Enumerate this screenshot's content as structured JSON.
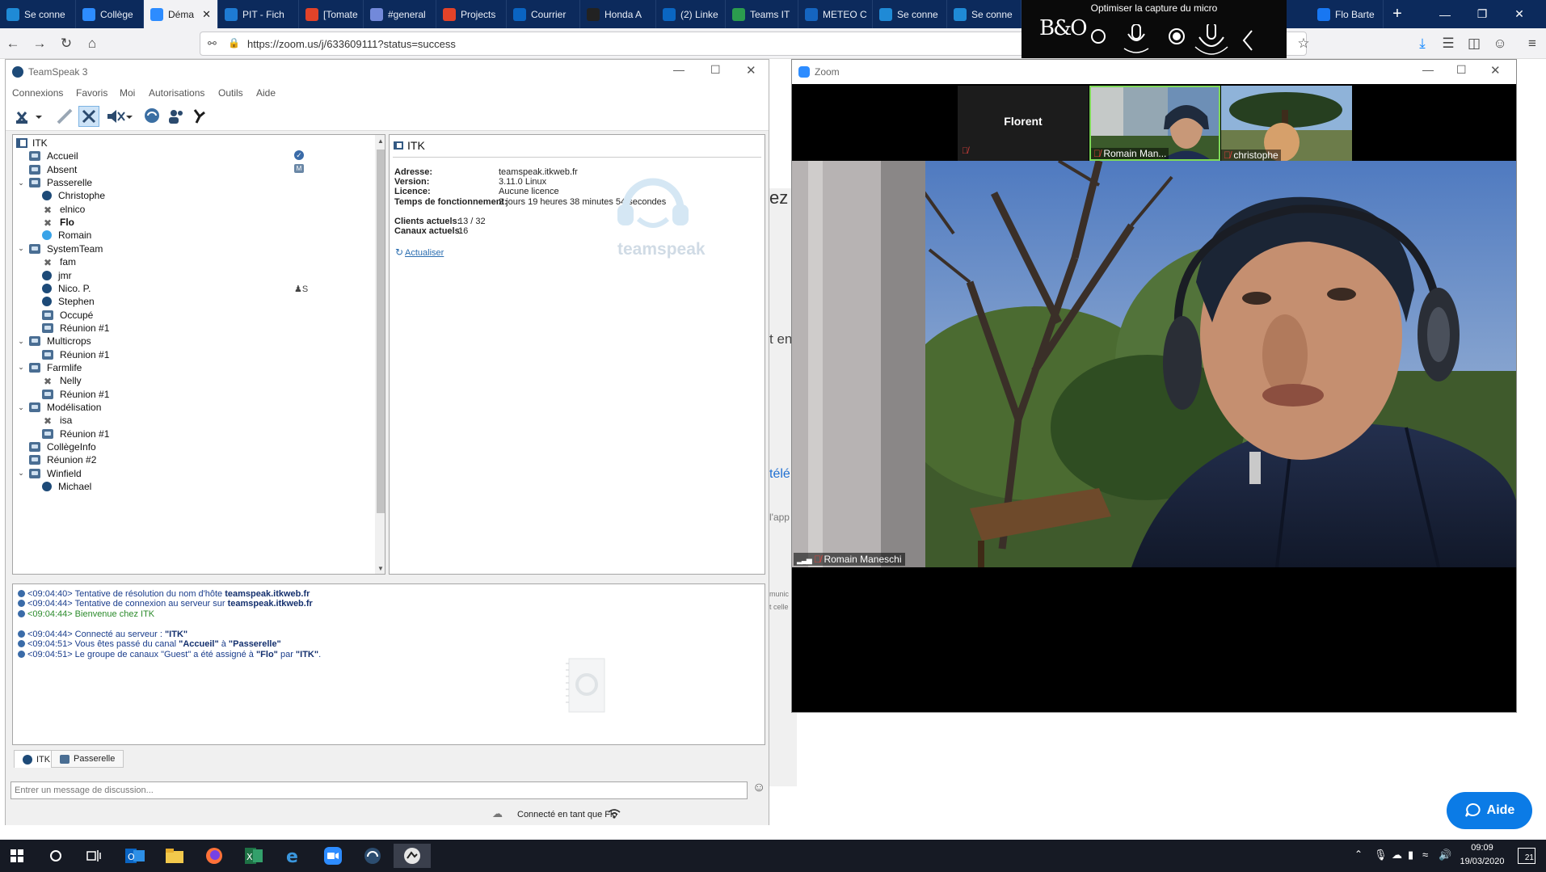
{
  "browser": {
    "tabs": [
      {
        "label": "Se conne",
        "icon": "cloud-icon",
        "color": "#1f8ad6"
      },
      {
        "label": "Collège",
        "icon": "zoom-icon",
        "color": "#2d8cff"
      },
      {
        "label": "Déma",
        "icon": "zoom-icon",
        "color": "#2d8cff",
        "active": true
      },
      {
        "label": "PIT - Fich",
        "icon": "nextcloud-icon",
        "color": "#1e7bd3"
      },
      {
        "label": "[Tomate",
        "icon": "gitlab-icon",
        "color": "#e24329"
      },
      {
        "label": "#general",
        "icon": "discord-icon",
        "color": "#7289da"
      },
      {
        "label": "Projects",
        "icon": "gitlab-icon",
        "color": "#e24329"
      },
      {
        "label": "Courrier",
        "icon": "outlook-icon",
        "color": "#0a64c2"
      },
      {
        "label": "Honda A",
        "icon": "honda-icon",
        "color": "#222222"
      },
      {
        "label": "(2) Linke",
        "icon": "linkedin-icon",
        "color": "#0a66c2"
      },
      {
        "label": "Teams IT",
        "icon": "teams-icon",
        "color": "#2b9c4e"
      },
      {
        "label": "METEO C",
        "icon": "meteo-icon",
        "color": "#1565c0"
      },
      {
        "label": "Se conne",
        "icon": "cloud-icon",
        "color": "#1f8ad6"
      },
      {
        "label": "Se conne",
        "icon": "cloud-icon",
        "color": "#1f8ad6"
      },
      {
        "label": "Flo Barte",
        "icon": "facebook-icon",
        "color": "#1877f2"
      }
    ],
    "url": "https://zoom.us/j/633609111?status=success"
  },
  "bo_overlay": {
    "title": "Optimiser la capture du micro",
    "logo": "B&O"
  },
  "teamspeak": {
    "title": "TeamSpeak 3",
    "menu": [
      "Connexions",
      "Favoris",
      "Moi",
      "Autorisations",
      "Outils",
      "Aide"
    ],
    "tree": {
      "server": "ITK",
      "rows": [
        {
          "label": "Accueil",
          "kind": "channel",
          "level": 1
        },
        {
          "label": "Absent",
          "kind": "channel",
          "level": 1
        },
        {
          "label": "Passerelle",
          "kind": "channel",
          "level": 1,
          "expanded": true
        },
        {
          "label": "Christophe",
          "kind": "user",
          "level": 2
        },
        {
          "label": "elnico",
          "kind": "user-muted",
          "level": 2
        },
        {
          "label": "Flo",
          "kind": "user-muted",
          "level": 2,
          "bold": true
        },
        {
          "label": "Romain",
          "kind": "user-talking",
          "level": 2
        },
        {
          "label": "SystemTeam",
          "kind": "channel",
          "level": 1,
          "expanded": true
        },
        {
          "label": "fam",
          "kind": "user-muted",
          "level": 2
        },
        {
          "label": "jmr",
          "kind": "user",
          "level": 2
        },
        {
          "label": "Nico. P.",
          "kind": "user",
          "level": 2
        },
        {
          "label": "Stephen",
          "kind": "user",
          "level": 2
        },
        {
          "label": "Occupé",
          "kind": "channel",
          "level": 2
        },
        {
          "label": "Réunion #1",
          "kind": "channel",
          "level": 2
        },
        {
          "label": "Multicrops",
          "kind": "channel",
          "level": 1,
          "expanded": true
        },
        {
          "label": "Réunion #1",
          "kind": "channel",
          "level": 2
        },
        {
          "label": "Farmlife",
          "kind": "channel",
          "level": 1,
          "expanded": true
        },
        {
          "label": "Nelly",
          "kind": "user-muted",
          "level": 2
        },
        {
          "label": "Réunion #1",
          "kind": "channel",
          "level": 2
        },
        {
          "label": "Modélisation",
          "kind": "channel",
          "level": 1,
          "expanded": true
        },
        {
          "label": "isa",
          "kind": "user-muted",
          "level": 2
        },
        {
          "label": "Réunion #1",
          "kind": "channel",
          "level": 2
        },
        {
          "label": "CollègeInfo",
          "kind": "channel",
          "level": 1
        },
        {
          "label": "Réunion #2",
          "kind": "channel",
          "level": 1
        },
        {
          "label": "Winfield",
          "kind": "channel",
          "level": 1,
          "expanded": true
        },
        {
          "label": "Michael",
          "kind": "user",
          "level": 2
        }
      ]
    },
    "info": {
      "title": "ITK",
      "labels": {
        "address": "Adresse:",
        "version": "Version:",
        "license": "Licence:",
        "uptime": "Temps de fonctionnement:",
        "clients": "Clients actuels:",
        "channels": "Canaux actuels:"
      },
      "values": {
        "address": "teamspeak.itkweb.fr",
        "version": "3.11.0 Linux",
        "license": "Aucune licence",
        "uptime": "2 jours 19 heures 38 minutes 54 secondes",
        "clients": "13 / 32",
        "channels": "16"
      },
      "refresh": "Actualiser",
      "logo_text": "teamspeak"
    },
    "log": [
      {
        "time": "<09:04:40>",
        "text": "Tentative de résolution du nom d'hôte ",
        "bold": "teamspeak.itkweb.fr",
        "tail": ""
      },
      {
        "time": "<09:04:44>",
        "text": "Tentative de connexion au serveur sur ",
        "bold": "teamspeak.itkweb.fr",
        "tail": ""
      },
      {
        "time": "<09:04:44>",
        "text": "Bienvenue chez ITK",
        "bold": "",
        "tail": "",
        "green": true
      },
      {
        "time": "<09:04:44>",
        "text": "Connecté au serveur : ",
        "bold": "\"ITK\"",
        "tail": ""
      },
      {
        "time": "<09:04:51>",
        "text": "Vous êtes passé du canal ",
        "bold": "\"Accueil\"",
        "tail": " à ",
        "bold2": "\"Passerelle\""
      },
      {
        "time": "<09:04:51>",
        "text": "Le groupe de canaux \"Guest\" a été assigné à ",
        "bold": "\"Flo\"",
        "tail": " par ",
        "bold2": "\"ITK\"",
        "end": "."
      }
    ],
    "tabs": [
      "ITK",
      "Passerelle"
    ],
    "chat_placeholder": "Entrer un message de discussion...",
    "status": "Connecté en tant que Flo"
  },
  "zoom": {
    "title": "Zoom",
    "participants": [
      {
        "name": "Florent",
        "muted": true
      },
      {
        "name": "Romain Man...",
        "muted": true
      },
      {
        "name": "christophe",
        "muted": true
      }
    ],
    "speaker": "Romain Maneschi"
  },
  "background_page": {
    "fragments": [
      "ez",
      "t en",
      "télé",
      "l'app",
      "munic",
      "t celle"
    ],
    "help_button": "Aide"
  },
  "taskbar": {
    "time": "09:09",
    "date": "19/03/2020",
    "notifications": "21"
  }
}
